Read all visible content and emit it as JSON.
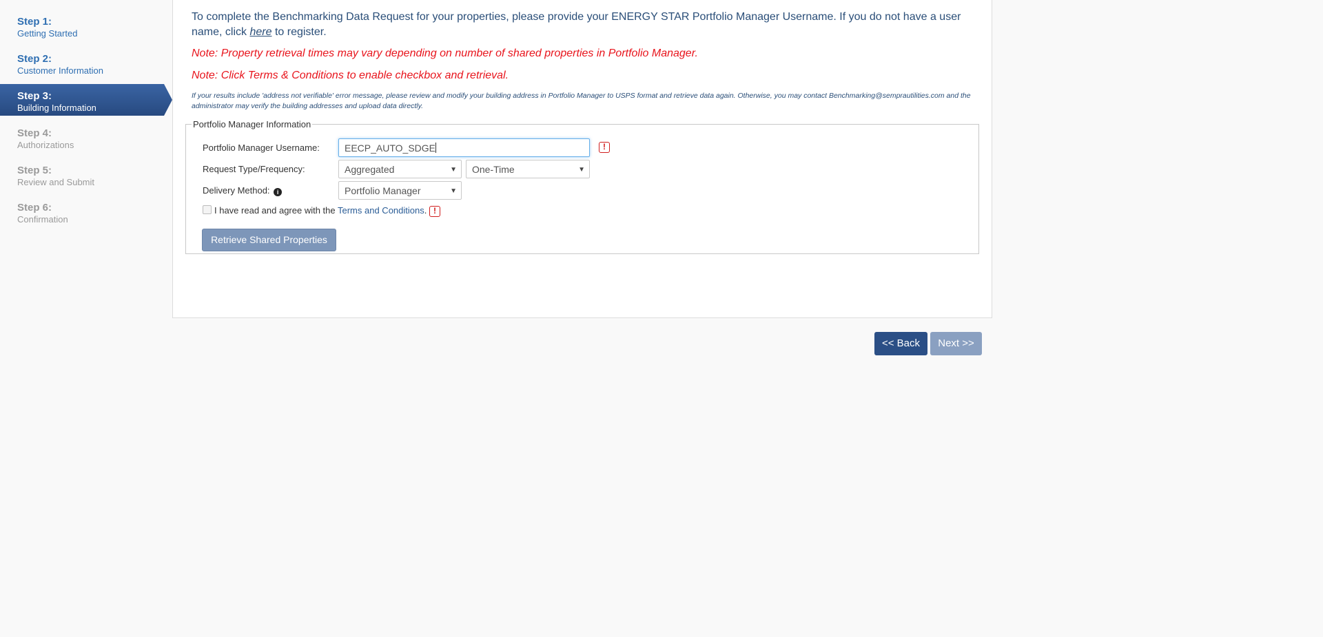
{
  "sidebar": {
    "steps": [
      {
        "num": "Step 1:",
        "label": "Getting Started"
      },
      {
        "num": "Step 2:",
        "label": "Customer Information"
      },
      {
        "num": "Step 3:",
        "label": "Building Information"
      },
      {
        "num": "Step 4:",
        "label": "Authorizations"
      },
      {
        "num": "Step 5:",
        "label": "Review and Submit"
      },
      {
        "num": "Step 6:",
        "label": "Confirmation"
      }
    ],
    "active_step": 3
  },
  "main": {
    "intro_before": "To complete the Benchmarking Data Request for your properties, please provide your ENERGY STAR Portfolio Manager Username. If you do not have a user name, click ",
    "intro_link": "here",
    "intro_after": " to register.",
    "note1": "Note: Property retrieval times may vary depending on number of shared properties in Portfolio Manager.",
    "note2": "Note: Click Terms & Conditions to enable checkbox and retrieval.",
    "small_note": "If your results include 'address not verifiable' error message, please review and modify your building address in Portfolio Manager to USPS format and retrieve data again. Otherwise, you may contact Benchmarking@semprautilities.com and the administrator may verify the building addresses and upload data directly."
  },
  "form": {
    "legend": "Portfolio Manager Information",
    "username_label": "Portfolio Manager Username:",
    "username_value": "EECP_AUTO_SDGE",
    "request_label": "Request Type/Frequency:",
    "request_type": "Aggregated",
    "frequency": "One-Time",
    "delivery_label": "Delivery Method:",
    "delivery_method": "Portfolio Manager",
    "agree_text": "I have read and agree with the ",
    "agree_link": "Terms and Conditions",
    "agree_end": ".",
    "retrieve_label": "Retrieve Shared Properties",
    "error_mark": "!",
    "info_mark": "i"
  },
  "nav": {
    "back_label": "<< Back",
    "next_label": "Next >>"
  },
  "colors": {
    "active_step": "#2b4f86",
    "note_red": "#e8141c",
    "link_blue": "#2a4e78"
  }
}
